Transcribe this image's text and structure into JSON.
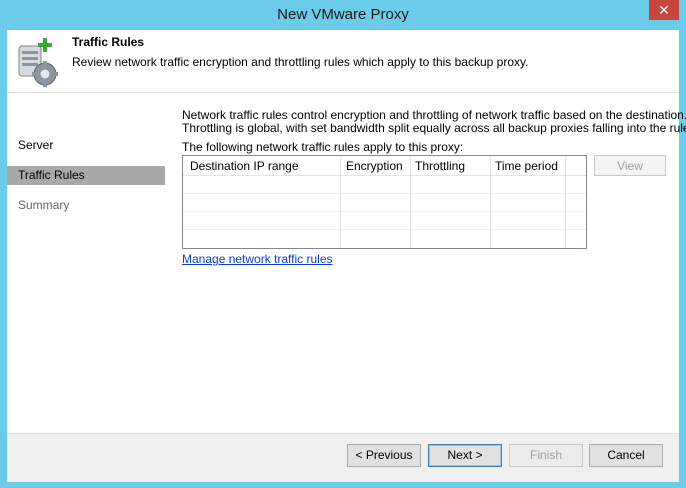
{
  "window": {
    "title": "New VMware Proxy",
    "close_glyph": "✕"
  },
  "header": {
    "title": "Traffic Rules",
    "description": "Review network traffic encryption and throttling rules which apply to this backup proxy.",
    "icon": "server-settings-icon"
  },
  "sidebar": {
    "items": [
      {
        "label": "Server",
        "state": "normal"
      },
      {
        "label": "Traffic Rules",
        "state": "active"
      },
      {
        "label": "Summary",
        "state": "disabled"
      }
    ]
  },
  "content": {
    "description_line1": "Network traffic rules control encryption and throttling of network traffic based on the destination.",
    "description_line2": "Throttling is global, with set bandwidth split equally across all backup proxies falling into the rule.",
    "rules_label": "The following network traffic rules apply to this proxy:",
    "table": {
      "columns": [
        "Destination IP range",
        "Encryption",
        "Throttling",
        "Time period"
      ],
      "rows": []
    },
    "view_button": "View",
    "manage_link": "Manage network traffic rules"
  },
  "footer": {
    "previous": "< Previous",
    "next": "Next >",
    "finish": "Finish",
    "cancel": "Cancel"
  },
  "colors": {
    "window_frame": "#6ccbe9",
    "close_button": "#c7463f",
    "active_nav": "#a9a9a9",
    "link": "#0a3bd6"
  }
}
